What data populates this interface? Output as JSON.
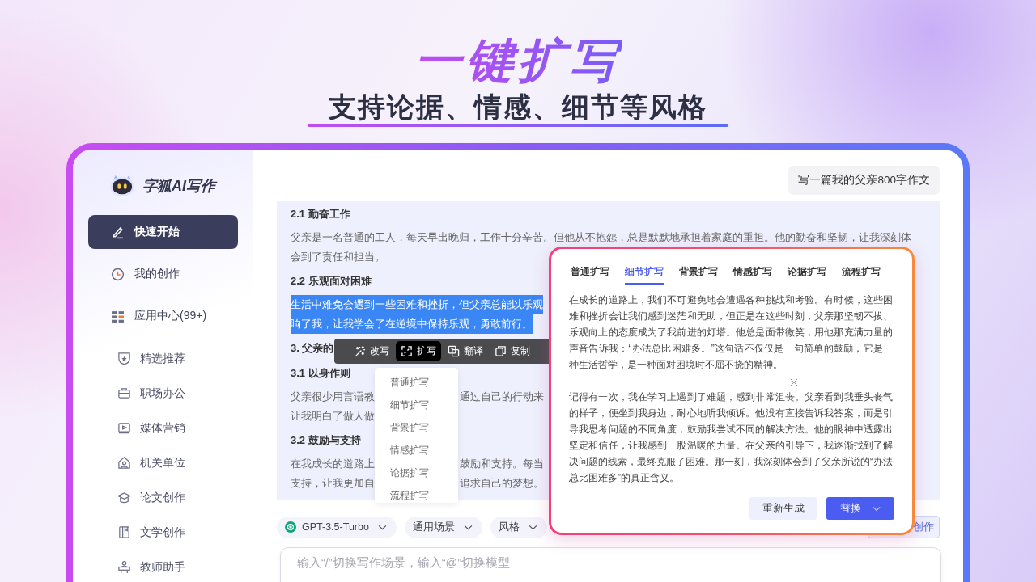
{
  "header": {
    "title": "一键扩写",
    "subtitle": "支持论据、情感、细节等风格"
  },
  "app": {
    "logo": "字狐AI写作",
    "nav": [
      {
        "label": "快速开始",
        "selected": true
      },
      {
        "label": "我的创作",
        "selected": false
      },
      {
        "label": "应用中心(99+)",
        "selected": false,
        "children": [
          {
            "label": "精选推荐",
            "selected": false
          },
          {
            "label": "职场办公",
            "selected": false
          },
          {
            "label": "媒体营销",
            "selected": false
          },
          {
            "label": "机关单位",
            "selected": false
          },
          {
            "label": "论文创作",
            "selected": false
          },
          {
            "label": "文学创作",
            "selected": false
          },
          {
            "label": "教师助手",
            "selected": false
          }
        ]
      }
    ],
    "prompt_chip": "写一篇我的父亲800字作文",
    "document": [
      {
        "kind": "heading",
        "selected": false,
        "lines": [
          [
            "2.1 勤奋工作"
          ]
        ]
      },
      {
        "kind": "paragraph",
        "selected": false,
        "lines": [
          [
            "父亲是一名普通的工人，每天早出晚归，工作十分辛苦。但他从不抱怨，总是默默地承担着家庭的重担。他的勤奋和坚韧，让我深刻体"
          ],
          [
            "会到了责任和担当。"
          ]
        ]
      },
      {
        "kind": "heading",
        "selected": false,
        "lines": [
          [
            "2.2 乐观面对困难"
          ]
        ]
      },
      {
        "kind": "paragraph",
        "selected": true,
        "lines": [
          [
            "生活中难免会遇到一些困难和挫折，但父亲总能以乐观"
          ],
          [
            "响了我，让我学会了在逆境中保持乐观，勇敢前行。"
          ]
        ]
      },
      {
        "kind": "heading",
        "selected": false,
        "lines": [
          [
            "3. 父亲的"
          ]
        ]
      },
      {
        "kind": "heading",
        "selected": false,
        "lines": [
          [
            "3.1 以身作则"
          ]
        ]
      },
      {
        "kind": "paragraph",
        "selected": false,
        "lines": [
          [
            "父亲很少用言语教",
            "通过自己的行动来"
          ],
          [
            "让我明白了做人做"
          ]
        ]
      },
      {
        "kind": "heading",
        "selected": false,
        "lines": [
          [
            "3.2 鼓励与支持"
          ]
        ]
      },
      {
        "kind": "paragraph",
        "selected": false,
        "lines": [
          [
            "在我成长的道路上",
            "鼓励和支持。每当"
          ],
          [
            "支持，让我更加自",
            "追求自己的梦想。"
          ]
        ]
      }
    ],
    "toolbar": [
      {
        "label": "改写",
        "selected": false
      },
      {
        "label": "扩写",
        "selected": true
      },
      {
        "label": "翻译",
        "selected": false
      },
      {
        "label": "复制",
        "selected": false
      }
    ],
    "expand_menu": [
      "普通扩写",
      "细节扩写",
      "背景扩写",
      "情感扩写",
      "论据扩写",
      "流程扩写"
    ],
    "controls": {
      "model": "GPT-3.5-Turbo",
      "scene": "通用场景",
      "style": "风格",
      "partial_chip": "创作"
    },
    "input": {
      "placeholder": "输入“/”切换写作场景，输入“@”切换模型"
    },
    "popup": {
      "tabs": [
        {
          "label": "普通扩写",
          "selected": false
        },
        {
          "label": "细节扩写",
          "selected": true
        },
        {
          "label": "背景扩写",
          "selected": false
        },
        {
          "label": "情感扩写",
          "selected": false
        },
        {
          "label": "论据扩写",
          "selected": false
        },
        {
          "label": "流程扩写",
          "selected": false
        }
      ],
      "paragraphs": [
        "在成长的道路上，我们不可避免地会遭遇各种挑战和考验。有时候，这些困难和挫折会让我们感到迷茫和无助，但正是在这些时刻，父亲那坚韧不拔、乐观向上的态度成为了我前进的灯塔。他总是面带微笑，用他那充满力量的声音告诉我：“办法总比困难多。”这句话不仅仅是一句简单的鼓励，它是一种生活哲学，是一种面对困境时不屈不挠的精神。",
        "记得有一次，我在学习上遇到了难题，感到非常沮丧。父亲看到我垂头丧气的样子，便坐到我身边，耐心地听我倾诉。他没有直接告诉我答案，而是引导我思考问题的不同角度，鼓励我尝试不同的解决方法。他的眼神中透露出坚定和信任，让我感到一股温暖的力量。在父亲的引导下，我逐渐找到了解决问题的线索，最终克服了困难。那一刻，我深刻体会到了父亲所说的“办法总比困难多”的真正含义。"
      ],
      "regenerate": "重新生成",
      "replace": "替换"
    }
  }
}
